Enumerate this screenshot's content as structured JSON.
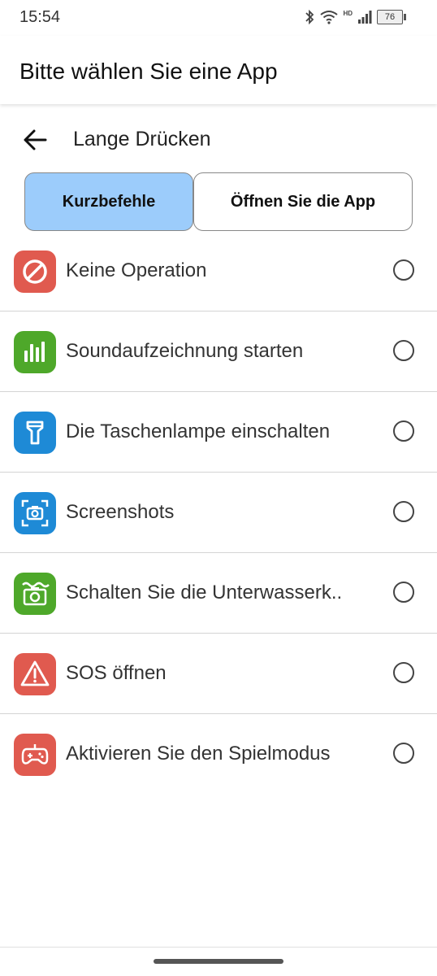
{
  "status_bar": {
    "time": "15:54",
    "battery": "76",
    "network_label": "HD"
  },
  "header": {
    "title": "Bitte wählen Sie eine App"
  },
  "nav": {
    "page_title": "Lange Drücken"
  },
  "tabs": [
    {
      "label": "Kurzbefehle",
      "active": true
    },
    {
      "label": "Öffnen Sie die App",
      "active": false
    }
  ],
  "options": [
    {
      "label": "Keine Operation",
      "icon": "prohibited-icon",
      "color": "#e05a4f",
      "selected": false
    },
    {
      "label": "Soundaufzeichnung starten",
      "icon": "sound-bars-icon",
      "color": "#4ea82a",
      "selected": false
    },
    {
      "label": "Die Taschenlampe einschalten",
      "icon": "flashlight-icon",
      "color": "#1e8ad6",
      "selected": false
    },
    {
      "label": "Screenshots",
      "icon": "screenshot-camera-icon",
      "color": "#1e8ad6",
      "selected": false
    },
    {
      "label": "Schalten Sie die Unterwasserk..",
      "icon": "underwater-camera-icon",
      "color": "#4ea82a",
      "selected": false
    },
    {
      "label": "SOS öffnen",
      "icon": "warning-triangle-icon",
      "color": "#e05a4f",
      "selected": false
    },
    {
      "label": "Aktivieren Sie den Spielmodus",
      "icon": "gamepad-icon",
      "color": "#e05a4f",
      "selected": false
    }
  ]
}
